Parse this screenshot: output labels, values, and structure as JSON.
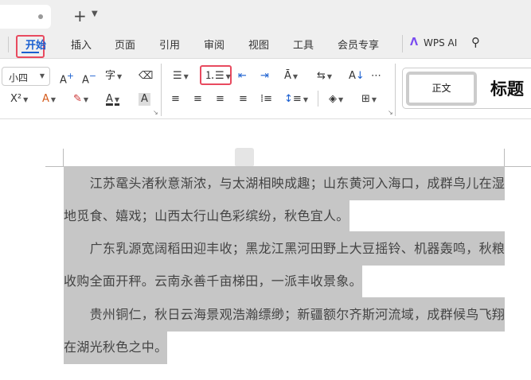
{
  "tabbar": {
    "new_tab": "+",
    "chevron": "⌄"
  },
  "menu": {
    "items": [
      "开始",
      "插入",
      "页面",
      "引用",
      "审阅",
      "视图",
      "工具",
      "会员专享"
    ],
    "wps_ai": "WPS AI"
  },
  "ribbon": {
    "font_size": "小四",
    "superscript": "X²",
    "styles": {
      "normal": "正文",
      "title": "标题"
    }
  },
  "document": {
    "paragraphs": [
      "江苏鼋头渚秋意渐浓，与太湖相映成趣；山东黄河入海口，成群鸟儿在湿地觅食、嬉戏；山西太行山色彩缤纷，秋色宜人。",
      "广东乳源宽阔稻田迎丰收；黑龙江黑河田野上大豆摇铃、机器轰鸣，秋粮收购全面开秤。云南永善千亩梯田，一派丰收景象。",
      "贵州铜仁，秋日云海景观浩瀚缥缈；新疆额尔齐斯河流域，成群候鸟飞翔在湖光秋色之中。"
    ]
  },
  "colors": {
    "accent": "#1a5fd0",
    "highlight_box": "#e84a5f",
    "selection": "#c6c6c6"
  }
}
